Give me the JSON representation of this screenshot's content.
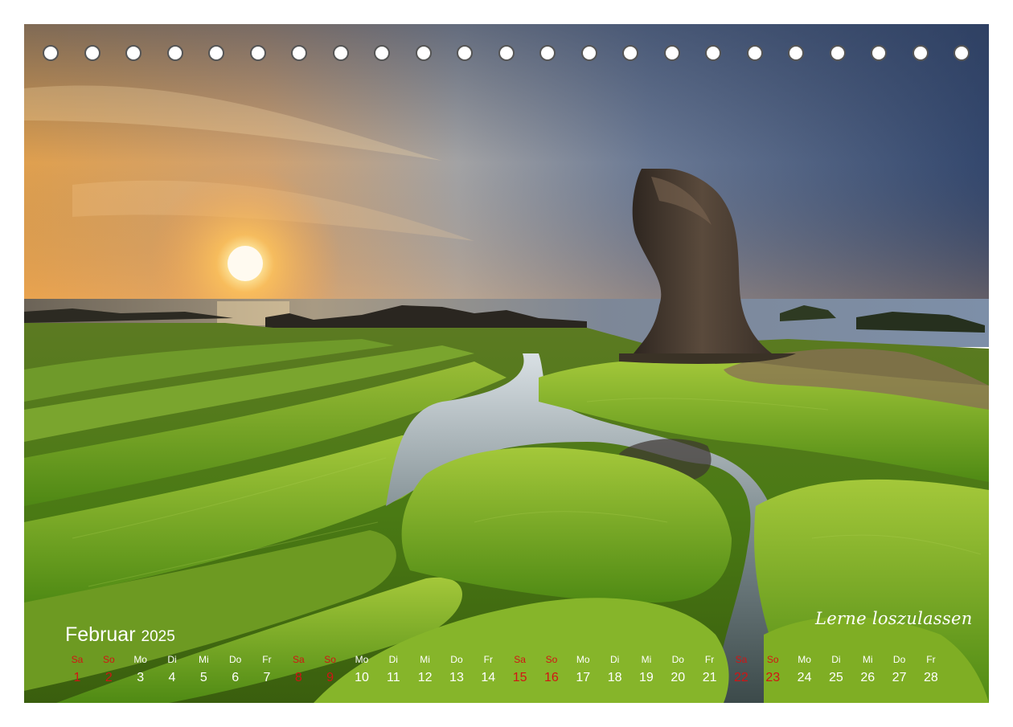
{
  "calendar": {
    "month": "Februar",
    "year": "2025",
    "slogan": "Lerne loszulassen",
    "days": [
      {
        "weekday": "Sa",
        "date": "1",
        "weekend": true
      },
      {
        "weekday": "So",
        "date": "2",
        "weekend": true
      },
      {
        "weekday": "Mo",
        "date": "3",
        "weekend": false
      },
      {
        "weekday": "Di",
        "date": "4",
        "weekend": false
      },
      {
        "weekday": "Mi",
        "date": "5",
        "weekend": false
      },
      {
        "weekday": "Do",
        "date": "6",
        "weekend": false
      },
      {
        "weekday": "Fr",
        "date": "7",
        "weekend": false
      },
      {
        "weekday": "Sa",
        "date": "8",
        "weekend": true
      },
      {
        "weekday": "So",
        "date": "9",
        "weekend": true
      },
      {
        "weekday": "Mo",
        "date": "10",
        "weekend": false
      },
      {
        "weekday": "Di",
        "date": "11",
        "weekend": false
      },
      {
        "weekday": "Mi",
        "date": "12",
        "weekend": false
      },
      {
        "weekday": "Do",
        "date": "13",
        "weekend": false
      },
      {
        "weekday": "Fr",
        "date": "14",
        "weekend": false
      },
      {
        "weekday": "Sa",
        "date": "15",
        "weekend": true
      },
      {
        "weekday": "So",
        "date": "16",
        "weekend": true
      },
      {
        "weekday": "Mo",
        "date": "17",
        "weekend": false
      },
      {
        "weekday": "Di",
        "date": "18",
        "weekend": false
      },
      {
        "weekday": "Mi",
        "date": "19",
        "weekend": false
      },
      {
        "weekday": "Do",
        "date": "20",
        "weekend": false
      },
      {
        "weekday": "Fr",
        "date": "21",
        "weekend": false
      },
      {
        "weekday": "Sa",
        "date": "22",
        "weekend": true
      },
      {
        "weekday": "So",
        "date": "23",
        "weekend": true
      },
      {
        "weekday": "Mo",
        "date": "24",
        "weekend": false
      },
      {
        "weekday": "Di",
        "date": "25",
        "weekend": false
      },
      {
        "weekday": "Mi",
        "date": "26",
        "weekend": false
      },
      {
        "weekday": "Do",
        "date": "27",
        "weekend": false
      },
      {
        "weekday": "Fr",
        "date": "28",
        "weekend": false
      }
    ]
  },
  "colors": {
    "weekend": "#d21414",
    "text": "#ffffff"
  }
}
